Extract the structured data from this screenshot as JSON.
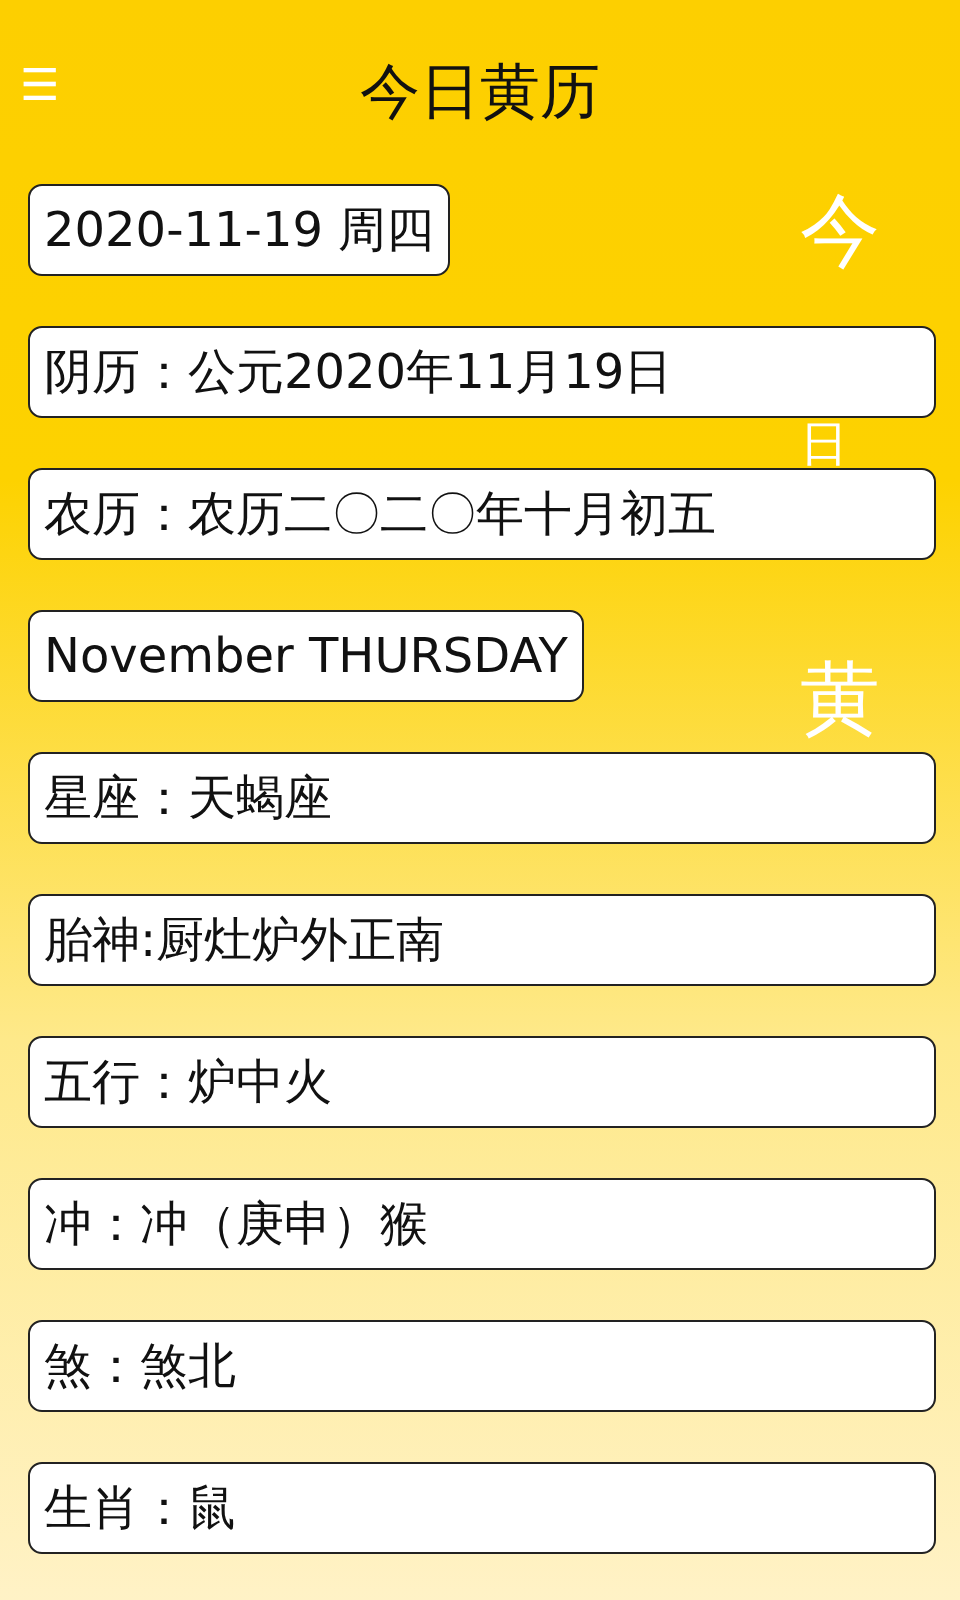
{
  "header": {
    "menu_icon": "☰",
    "title": "今日黄历"
  },
  "calligraphy": [
    "今",
    "日",
    "黄"
  ],
  "cards": [
    {
      "kind": "compact",
      "text": "2020-11-19  周四"
    },
    {
      "kind": "full",
      "text": "阴历：公元2020年11月19日"
    },
    {
      "kind": "full",
      "text": "农历：农历二〇二〇年十月初五"
    },
    {
      "kind": "compact",
      "text": "November THURSDAY"
    },
    {
      "kind": "full",
      "text": "星座：天蝎座"
    },
    {
      "kind": "full",
      "text": "胎神:厨灶炉外正南"
    },
    {
      "kind": "full",
      "text": "五行：炉中火"
    },
    {
      "kind": "full",
      "text": "冲：冲（庚申）猴"
    },
    {
      "kind": "full",
      "text": "煞：煞北"
    },
    {
      "kind": "full",
      "text": "生肖：鼠"
    }
  ]
}
